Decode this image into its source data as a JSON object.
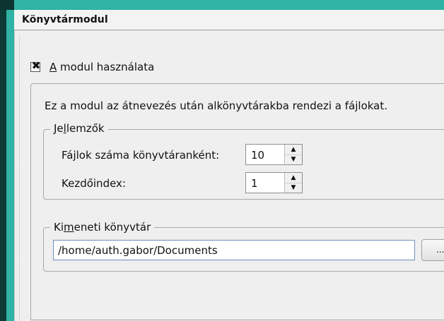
{
  "window": {
    "title": "Könyvtármodul"
  },
  "module": {
    "use_checked": true,
    "use_label_accel": "A",
    "use_label_rest": " modul használata",
    "checkbox_glyph": "✖"
  },
  "description": "Ez a modul az átnevezés után alkönyvtárakba rendezi a fájlokat.",
  "properties": {
    "title_pre": "Je",
    "title_accel": "l",
    "title_post": "lemzők",
    "files_per_dir_label": "Fájlok száma könyvtáranként:",
    "files_per_dir_value": "10",
    "start_index_label": "Kezdőindex:",
    "start_index_value": "1",
    "spin_up_glyph": "▲",
    "spin_down_glyph": "▼"
  },
  "output": {
    "title_pre": "Ki",
    "title_accel": "m",
    "title_post": "eneti könyvtár",
    "path_value": "/home/auth.gabor/Documents",
    "browse_label": "..."
  },
  "colors": {
    "teal": "#2fb3a4",
    "panel_bg": "#efefef"
  }
}
